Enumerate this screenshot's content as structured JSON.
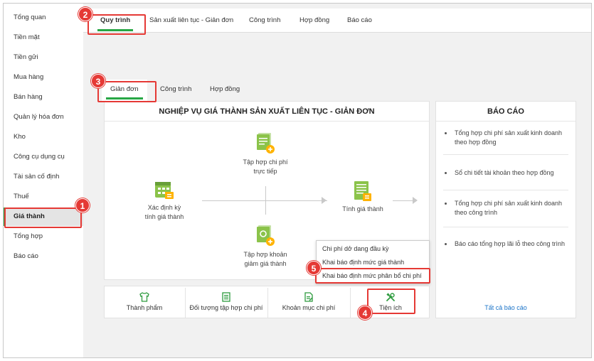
{
  "sidebar": {
    "items": [
      {
        "label": "Tổng quan"
      },
      {
        "label": "Tiền mặt"
      },
      {
        "label": "Tiền gửi"
      },
      {
        "label": "Mua hàng"
      },
      {
        "label": "Bán hàng"
      },
      {
        "label": "Quản lý hóa đơn"
      },
      {
        "label": "Kho"
      },
      {
        "label": "Công cụ dụng cụ"
      },
      {
        "label": "Tài sản cố định"
      },
      {
        "label": "Thuế"
      },
      {
        "label": "Giá thành"
      },
      {
        "label": "Tổng hợp"
      },
      {
        "label": "Báo cáo"
      }
    ],
    "active": "Giá thành"
  },
  "top_tabs": [
    {
      "label": "Quy trình"
    },
    {
      "label": "Sản xuất liên tục - Giản đơn"
    },
    {
      "label": "Công trình"
    },
    {
      "label": "Hợp đồng"
    },
    {
      "label": "Báo cáo"
    }
  ],
  "sub_tabs": [
    {
      "label": "Giản đơn"
    },
    {
      "label": "Công trình"
    },
    {
      "label": "Hợp đồng"
    }
  ],
  "process": {
    "title": "NGHIỆP VỤ GIÁ THÀNH SẢN XUẤT LIÊN TỤC - GIẢN ĐƠN",
    "nodes": {
      "define_period": "Xác định kỳ\ntính giá thành",
      "collect_costs": "Tập hợp chi phí\ntrực tiếp",
      "collect_reductions": "Tập hợp khoản\ngiảm giá thành",
      "calculate": "Tính giá thành"
    }
  },
  "popup_menu": {
    "items": [
      {
        "label": "Chi phí dở dang đầu kỳ"
      },
      {
        "label": "Khai báo định mức giá thành"
      },
      {
        "label": "Khai báo định mức phân bổ chi phí"
      }
    ]
  },
  "bottom_bar": {
    "items": [
      {
        "label": "Thành phẩm",
        "icon": "shirt-icon"
      },
      {
        "label": "Đối tượng tập hợp chi phí",
        "icon": "document-list-icon"
      },
      {
        "label": "Khoản mục chi phí",
        "icon": "document-edit-icon"
      },
      {
        "label": "Tiện ích",
        "icon": "tools-icon"
      }
    ]
  },
  "reports": {
    "title": "BÁO CÁO",
    "items": [
      {
        "label": "Tổng hợp chi phí sản xuất kinh doanh\ntheo hợp đồng"
      },
      {
        "label": "Sổ chi tiết tài khoản theo hợp đồng"
      },
      {
        "label": "Tổng hợp chi phí sản xuất kinh doanh\ntheo công trình"
      },
      {
        "label": "Báo cáo tổng hợp lãi lỗ theo công trình"
      }
    ],
    "all_link": "Tất cả báo cáo"
  },
  "annotations": [
    "1",
    "2",
    "3",
    "4",
    "5"
  ],
  "colors": {
    "accent": "#28a745",
    "highlight": "#e53935",
    "link": "#1a73c8",
    "icon_green": "#8bc34a",
    "icon_orange": "#ffb300"
  }
}
